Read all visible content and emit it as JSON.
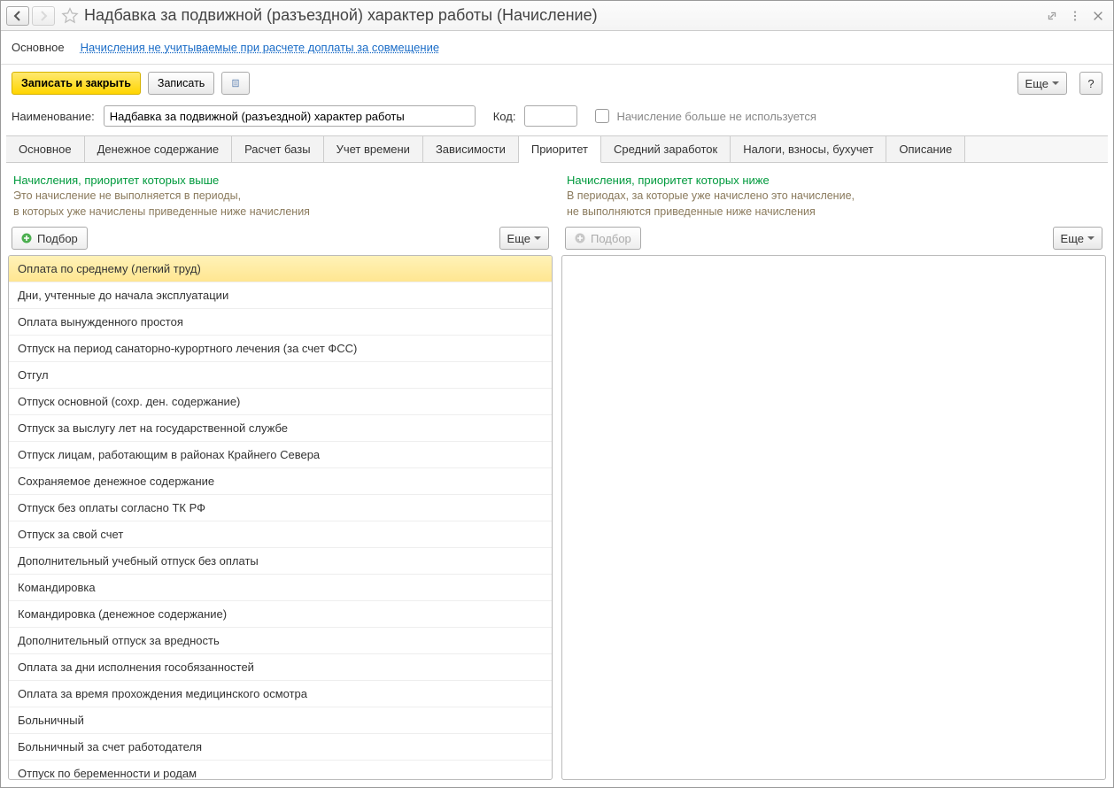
{
  "titlebar": {
    "title": "Надбавка за подвижной (разъездной) характер работы (Начисление)"
  },
  "subnav": {
    "main": "Основное",
    "secondary": "Начисления не учитываемые при расчете доплаты за совмещение"
  },
  "cmdbar": {
    "save_close": "Записать и закрыть",
    "save": "Записать",
    "more": "Еще",
    "help": "?"
  },
  "form": {
    "name_label": "Наименование:",
    "name_value": "Надбавка за подвижной (разъездной) характер работы",
    "code_label": "Код:",
    "code_value": "",
    "not_used_label": "Начисление больше не используется"
  },
  "tabs": [
    "Основное",
    "Денежное содержание",
    "Расчет базы",
    "Учет времени",
    "Зависимости",
    "Приоритет",
    "Средний заработок",
    "Налоги, взносы, бухучет",
    "Описание"
  ],
  "tabs_active_index": 5,
  "left": {
    "title": "Начисления, приоритет которых выше",
    "desc1": "Это начисление не выполняется в периоды,",
    "desc2": "в которых уже начислены приведенные ниже начисления",
    "select": "Подбор",
    "more": "Еще",
    "items": [
      "Оплата по среднему (легкий труд)",
      "Дни, учтенные до начала эксплуатации",
      "Оплата вынужденного простоя",
      "Отпуск на период санаторно-курортного лечения (за счет ФСС)",
      "Отгул",
      "Отпуск основной (сохр. ден. содержание)",
      "Отпуск за выслугу лет на государственной службе",
      "Отпуск лицам, работающим в районах Крайнего Севера",
      "Сохраняемое денежное содержание",
      "Отпуск без оплаты согласно ТК РФ",
      "Отпуск за свой счет",
      "Дополнительный учебный отпуск без оплаты",
      "Командировка",
      "Командировка (денежное содержание)",
      "Дополнительный отпуск за вредность",
      "Оплата за дни исполнения гособязанностей",
      "Оплата за время прохождения медицинского осмотра",
      "Больничный",
      "Больничный за счет работодателя",
      "Отпуск по беременности и родам"
    ],
    "selected_index": 0
  },
  "right": {
    "title": "Начисления, приоритет которых ниже",
    "desc1": "В периодах, за которые уже начислено это начисление,",
    "desc2": "не выполняются приведенные ниже начисления",
    "select": "Подбор",
    "more": "Еще"
  }
}
